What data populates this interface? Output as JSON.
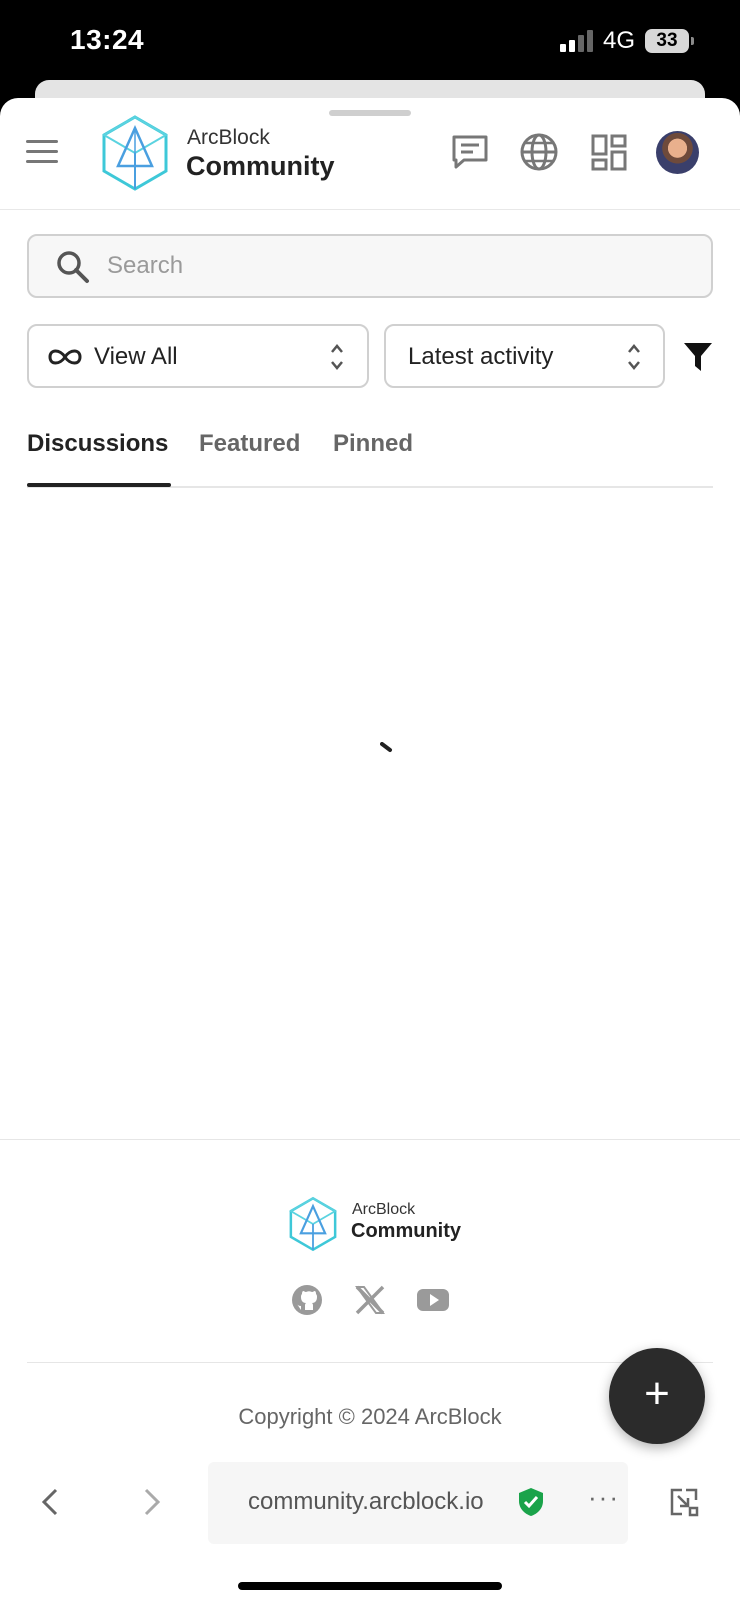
{
  "status_bar": {
    "time": "13:24",
    "network": "4G",
    "battery": "33"
  },
  "header": {
    "brand_top": "ArcBlock",
    "brand_main": "Community",
    "icons": [
      "menu-icon",
      "chat-icon",
      "globe-icon",
      "apps-grid-icon",
      "avatar"
    ]
  },
  "search": {
    "placeholder": "Search",
    "value": ""
  },
  "filters": {
    "scope": "View All",
    "sort": "Latest activity"
  },
  "tabs": [
    {
      "label": "Discussions",
      "active": true
    },
    {
      "label": "Featured",
      "active": false
    },
    {
      "label": "Pinned",
      "active": false
    }
  ],
  "footer": {
    "brand_top": "ArcBlock",
    "brand_main": "Community",
    "social": [
      "github-icon",
      "x-icon",
      "youtube-icon"
    ],
    "copyright": "Copyright © 2024 ArcBlock"
  },
  "fab_label": "+",
  "browser": {
    "url": "community.arcblock.io",
    "more": "···"
  },
  "colors": {
    "brand_teal": "#3ec8d8",
    "brand_blue": "#4a9fe0",
    "fab_bg": "#2b2b2b",
    "secure_green": "#1aa34a"
  }
}
